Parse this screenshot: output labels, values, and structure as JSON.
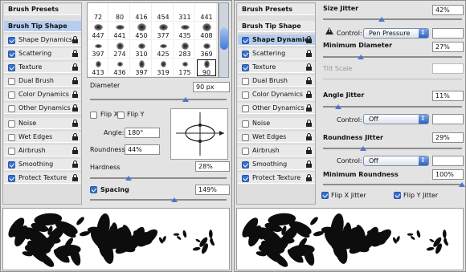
{
  "sidebar": {
    "brush_presets": "Brush Presets",
    "items": [
      {
        "label": "Brush Tip Shape"
      },
      {
        "label": "Shape Dynamics"
      },
      {
        "label": "Scattering"
      },
      {
        "label": "Texture"
      },
      {
        "label": "Dual Brush"
      },
      {
        "label": "Color Dynamics"
      },
      {
        "label": "Other Dynamics"
      },
      {
        "label": "Noise"
      },
      {
        "label": "Wet Edges"
      },
      {
        "label": "Airbrush"
      },
      {
        "label": "Smoothing"
      },
      {
        "label": "Protect Texture"
      }
    ]
  },
  "brush_grid": {
    "rows": [
      [
        "72",
        "80",
        "416",
        "454",
        "311",
        "441"
      ],
      [
        "447",
        "441",
        "450",
        "377",
        "435",
        "408"
      ],
      [
        "397",
        "274",
        "310",
        "425",
        "283",
        "369"
      ],
      [
        "413",
        "436",
        "397",
        "319",
        "175",
        "90"
      ]
    ],
    "selected": "90"
  },
  "tip_shape": {
    "diameter_label": "Diameter",
    "diameter_value": "90 px",
    "diameter_level": 0.7,
    "flip_x": "Flip X",
    "flip_y": "Flip Y",
    "angle_label": "Angle:",
    "angle_value": "180°",
    "roundness_label": "Roundness:",
    "roundness_value": "44%",
    "hardness_label": "Hardness",
    "hardness_value": "28%",
    "hardness_level": 0.28,
    "spacing_label": "Spacing",
    "spacing_value": "149%",
    "spacing_level": 0.62
  },
  "dynamics": {
    "size_jitter_label": "Size Jitter",
    "size_jitter_value": "42%",
    "size_jitter_level": 0.42,
    "control_label": "Control:",
    "control_size": "Pen Pressure",
    "min_diameter_label": "Minimum Diameter",
    "min_diameter_value": "27%",
    "min_diameter_level": 0.27,
    "tilt_scale_label": "Tilt Scale",
    "angle_jitter_label": "Angle Jitter",
    "angle_jitter_value": "11%",
    "angle_jitter_level": 0.11,
    "control_angle": "Off",
    "roundness_jitter_label": "Roundness Jitter",
    "roundness_jitter_value": "29%",
    "roundness_jitter_level": 0.29,
    "control_roundness": "Off",
    "min_roundness_label": "Minimum Roundness",
    "min_roundness_value": "100%",
    "min_roundness_level": 1.0,
    "flip_x_jitter": "Flip X Jitter",
    "flip_y_jitter": "Flip Y Jitter"
  },
  "colors": {
    "selected_row": "#b5cdee",
    "accent": "#3a6fd0"
  }
}
